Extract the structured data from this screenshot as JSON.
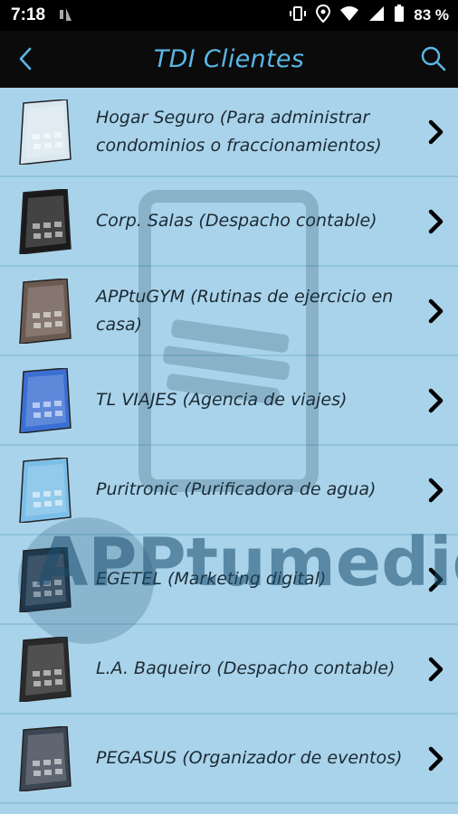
{
  "status_bar": {
    "time": "7:18",
    "battery": "83 %",
    "icons": [
      "signal-icon",
      "vibrate-icon",
      "location-icon",
      "wifi-icon",
      "cellular-icon",
      "battery-icon"
    ]
  },
  "app_bar": {
    "title": "TDI Clientes",
    "back_icon": "back-arrow-icon",
    "search_icon": "search-icon",
    "title_color": "#5ab7e6"
  },
  "watermark": {
    "text": "APPtumedida"
  },
  "clients": [
    {
      "label": "Hogar Seguro (Para administrar condominios o fraccionamientos)",
      "thumb_color": "#d9e8f0"
    },
    {
      "label": "Corp. Salas (Despacho contable)",
      "thumb_color": "#1a1a1a"
    },
    {
      "label": "APPtuGYM (Rutinas de ejercicio en casa)",
      "thumb_color": "#6b5a50"
    },
    {
      "label": "TL VIAJES (Agencia de viajes)",
      "thumb_color": "#3b6fd4"
    },
    {
      "label": "Puritronic (Purificadora de agua)",
      "thumb_color": "#7bbfe8"
    },
    {
      "label": "EGETEL (Marketing digital)",
      "thumb_color": "#233447"
    },
    {
      "label": "L.A. Baqueiro (Despacho contable)",
      "thumb_color": "#2a2a2a"
    },
    {
      "label": "PEGASUS (Organizador de eventos)",
      "thumb_color": "#3c4552"
    }
  ]
}
